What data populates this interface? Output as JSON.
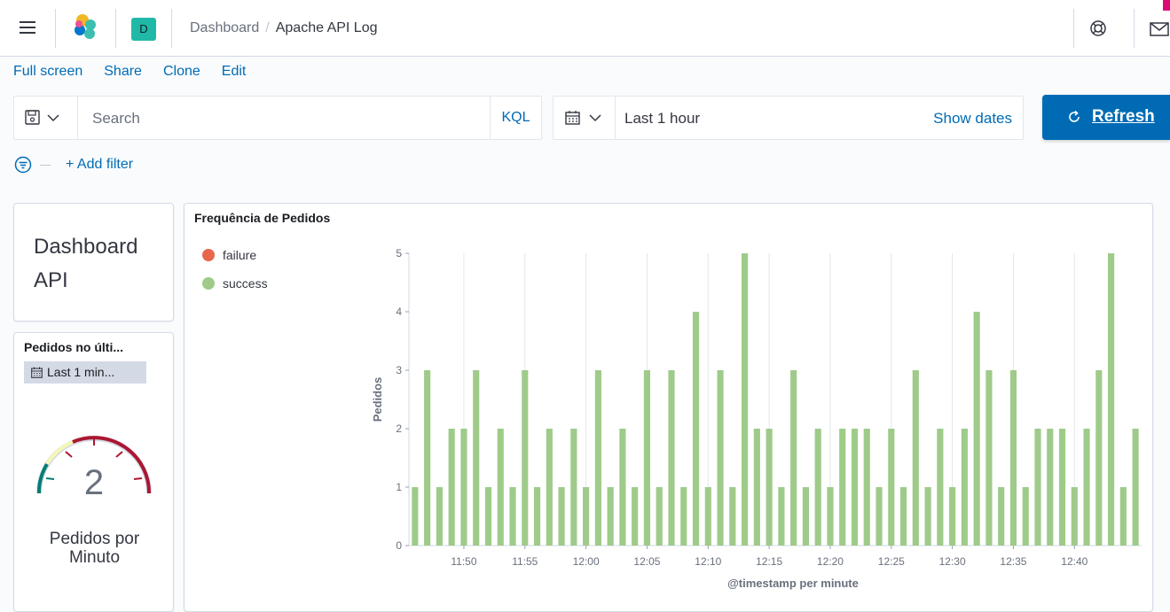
{
  "header": {
    "space_initial": "D",
    "breadcrumb": [
      "Dashboard",
      "Apache API Log"
    ]
  },
  "topnav": [
    "Full screen",
    "Share",
    "Clone",
    "Edit"
  ],
  "query": {
    "placeholder": "Search",
    "language": "KQL"
  },
  "time": {
    "range": "Last 1 hour",
    "show_dates": "Show dates",
    "refresh": "Refresh"
  },
  "filter": {
    "add": "+ Add filter"
  },
  "markdown_panel": {
    "line1": "Dashboard",
    "line2": "API"
  },
  "gauge_panel": {
    "title": "Pedidos no últi...",
    "time_badge": "Last 1 min...",
    "value": "2",
    "label_line1": "Pedidos por",
    "label_line2": "Minuto",
    "colors": {
      "low": "#017d73",
      "mid": "#f5f7b4",
      "high": "#ac1732",
      "track": "#d3dae6"
    }
  },
  "chart_panel": {
    "title": "Frequência de Pedidos",
    "legend": [
      {
        "name": "failure",
        "color": "#e7664c"
      },
      {
        "name": "success",
        "color": "#9fcb8a"
      }
    ]
  },
  "chart_data": {
    "type": "bar",
    "title": "Frequência de Pedidos",
    "xlabel": "@timestamp per minute",
    "ylabel": "Pedidos",
    "ylim": [
      0,
      5
    ],
    "yticks": [
      0,
      1,
      2,
      3,
      4,
      5
    ],
    "xticks": [
      "11:50",
      "11:55",
      "12:00",
      "12:05",
      "12:10",
      "12:15",
      "12:20",
      "12:25",
      "12:30",
      "12:35",
      "12:40"
    ],
    "x_start": "11:46",
    "x_end": "12:45",
    "grid": true,
    "series": [
      {
        "name": "success",
        "color": "#9fcb8a",
        "values": [
          1,
          3,
          1,
          2,
          2,
          3,
          1,
          2,
          1,
          3,
          1,
          2,
          1,
          2,
          1,
          3,
          1,
          2,
          1,
          3,
          1,
          3,
          1,
          4,
          1,
          3,
          1,
          5,
          2,
          2,
          1,
          3,
          1,
          2,
          1,
          2,
          2,
          2,
          1,
          2,
          1,
          3,
          1,
          2,
          1,
          2,
          4,
          3,
          1,
          3,
          1,
          2,
          2,
          2,
          1,
          2,
          3,
          5,
          1,
          2
        ]
      },
      {
        "name": "failure",
        "color": "#e7664c",
        "values": []
      }
    ]
  }
}
